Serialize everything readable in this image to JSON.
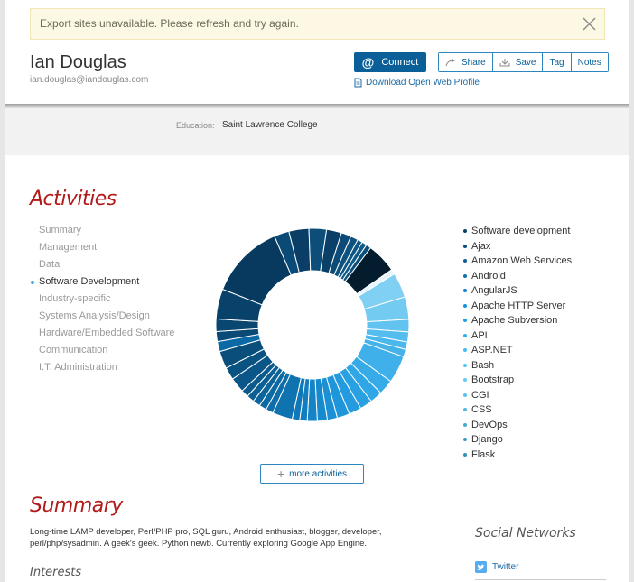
{
  "alert": {
    "message": "Export sites unavailable. Please refresh and try again."
  },
  "profile": {
    "name": "Ian Douglas",
    "email": "ian.douglas@iandouglas.com"
  },
  "actions": {
    "connect_label": "Connect",
    "share_label": "Share",
    "save_label": "Save",
    "tag_label": "Tag",
    "notes_label": "Notes",
    "download_label": "Download Open Web Profile"
  },
  "education": {
    "label": "Education:",
    "value": "Saint Lawrence College"
  },
  "activities": {
    "title": "Activities",
    "nav": [
      "Summary",
      "Management",
      "Data",
      "Software Development",
      "Industry-specific",
      "Systems Analysis/Design",
      "Hardware/Embedded Software",
      "Communication",
      "I.T. Administration"
    ],
    "active_index": 3,
    "legend": [
      "Software development",
      "Ajax",
      "Amazon Web Services",
      "Android",
      "AngularJS",
      "Apache HTTP Server",
      "Apache Subversion",
      "API",
      "ASP.NET",
      "Bash",
      "Bootstrap",
      "CGI",
      "CSS",
      "DevOps",
      "Django",
      "Flask"
    ],
    "legend_colors": [
      "#0b3f66",
      "#0b4f7f",
      "#0d5f98",
      "#0f70b2",
      "#1181c9",
      "#1892d8",
      "#22a2e4",
      "#33b0ec",
      "#45bbf0",
      "#56c4f2",
      "#64cbf3",
      "#5ec2ea",
      "#54b6de",
      "#48a9d2",
      "#3d9bc4",
      "#3490b8"
    ],
    "more_label": "more activities"
  },
  "chart_data": {
    "type": "pie",
    "segments": [
      {
        "value": 30,
        "color": "#083a5f"
      },
      {
        "value": 6,
        "color": "#0b4a76"
      },
      {
        "value": 8,
        "color": "#0a3e66"
      },
      {
        "value": 7,
        "color": "#0c4d7a"
      },
      {
        "value": 6,
        "color": "#0a3f67"
      },
      {
        "value": 4,
        "color": "#0c4b78"
      },
      {
        "value": 3,
        "color": "#0d527f"
      },
      {
        "value": 2,
        "color": "#0e5785"
      },
      {
        "value": 2,
        "color": "#0f5c8b"
      },
      {
        "value": 2,
        "color": "#0d4f7c"
      },
      {
        "value": 12,
        "color": "#031c2e"
      },
      {
        "value": 2,
        "color": "#e8f6fc"
      },
      {
        "value": 10,
        "color": "#7fd0f3"
      },
      {
        "value": 9,
        "color": "#73cbf2"
      },
      {
        "value": 5,
        "color": "#62c3f0"
      },
      {
        "value": 4,
        "color": "#55bdee"
      },
      {
        "value": 3,
        "color": "#4bb7ec"
      },
      {
        "value": 3,
        "color": "#45b3ea"
      },
      {
        "value": 11,
        "color": "#3fb0ea"
      },
      {
        "value": 6,
        "color": "#36abe8"
      },
      {
        "value": 5,
        "color": "#2fa6e6"
      },
      {
        "value": 5,
        "color": "#28a0e2"
      },
      {
        "value": 5,
        "color": "#239bde"
      },
      {
        "value": 5,
        "color": "#1f96da"
      },
      {
        "value": 4,
        "color": "#1b90d4"
      },
      {
        "value": 4,
        "color": "#178acd"
      },
      {
        "value": 4,
        "color": "#1484c6"
      },
      {
        "value": 3,
        "color": "#127ebf"
      },
      {
        "value": 3,
        "color": "#1078b8"
      },
      {
        "value": 8,
        "color": "#0f73b0"
      },
      {
        "value": 3,
        "color": "#0e6ea9"
      },
      {
        "value": 3,
        "color": "#0d69a2"
      },
      {
        "value": 3,
        "color": "#0c649b"
      },
      {
        "value": 3,
        "color": "#0b5f94"
      },
      {
        "value": 3,
        "color": "#0b5a8d"
      },
      {
        "value": 6,
        "color": "#0b5688"
      },
      {
        "value": 5,
        "color": "#0a5282"
      },
      {
        "value": 7,
        "color": "#0a4e7c"
      },
      {
        "value": 4,
        "color": "#0b6aa6"
      },
      {
        "value": 4,
        "color": "#0a4a76"
      },
      {
        "value": 5,
        "color": "#094670"
      },
      {
        "value": 12,
        "color": "#08426a"
      }
    ]
  },
  "summary": {
    "title": "Summary",
    "text": "Long-time LAMP developer, Perl/PHP pro, SQL guru, Android enthusiast, blogger, developer, perl/php/sysadmin. A geek's geek. Python newb. Currently exploring Google App Engine.",
    "interests_title": "Interests"
  },
  "social": {
    "title": "Social Networks",
    "twitter_label": "Twitter"
  }
}
